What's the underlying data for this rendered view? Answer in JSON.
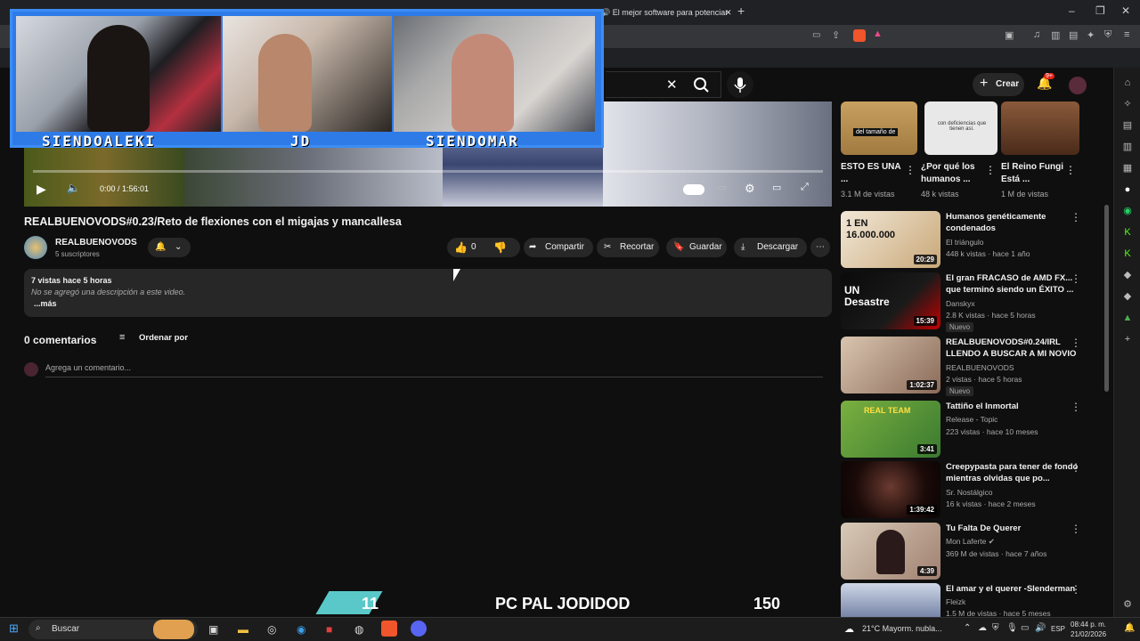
{
  "browser": {
    "tab_title": "El mejor software para potenciar",
    "new_tab": "+",
    "win_min": "–",
    "win_max": "❐",
    "win_close": "✕"
  },
  "overlay": {
    "cam_labels": [
      "SIENDOALEKI",
      "JD",
      "SIENDOMAR"
    ],
    "banner_left_number": "11",
    "banner_title": "PC PAL JODIDOD",
    "banner_right_number": "150"
  },
  "header": {
    "create_label": "Crear",
    "notif_count": "9+"
  },
  "player": {
    "time": "0:00 / 1:56:01"
  },
  "video": {
    "title": "REALBUENOVODS#0.23/Reto de flexiones con el migajas y mancallesa",
    "channel_name": "REALBUENOVODS",
    "subscribers": "5 suscriptores",
    "likes": "0",
    "share": "Compartir",
    "clip": "Recortar",
    "save": "Guardar",
    "download": "Descargar",
    "stats": "7 vistas  hace 5 horas",
    "description": "No se agregó una descripción a este video.",
    "more": "...más"
  },
  "comments": {
    "count_label": "0 comentarios",
    "sort_label": "Ordenar por",
    "placeholder": "Agrega un comentario..."
  },
  "shorts": [
    {
      "title": "ESTO ES UNA ...",
      "views": "3.1 M de vistas",
      "thumb_text": "del tamaño de"
    },
    {
      "title": "¿Por qué los humanos ...",
      "views": "48 k vistas",
      "thumb_text": "con deficiencias que tienen así."
    },
    {
      "title": "El Reino Fungi Está ...",
      "views": "1 M de vistas",
      "thumb_text": ""
    }
  ],
  "recommendations": [
    {
      "title": "Humanos genéticamente condenados",
      "channel": "El triángulo",
      "meta": "448 k vistas · hace 1 año",
      "duration": "20:29",
      "thumb_text": "1 EN 16.000.000",
      "badge": ""
    },
    {
      "title": "El gran FRACASO de AMD FX... que terminó siendo un ÉXITO ...",
      "channel": "Danskyx",
      "meta": "2.8 K vistas · hace 5 horas",
      "duration": "15:39",
      "thumb_text": "UN Desastre",
      "badge": "Nuevo"
    },
    {
      "title": "REALBUENOVODS#0.24/IRL LLENDO A BUSCAR A MI NOVIO",
      "channel": "REALBUENOVODS",
      "meta": "2 vistas · hace 5 horas",
      "duration": "1:02:37",
      "thumb_text": "",
      "badge": "Nuevo"
    },
    {
      "title": "Tattiño el Inmortal",
      "channel": "Release - Topic",
      "meta": "223 vistas · hace 10 meses",
      "duration": "3:41",
      "thumb_text": "REAL TEAM",
      "badge": ""
    },
    {
      "title": "Creepypasta para tener de fondo mientras olvidas que po...",
      "channel": "Sr. Nostálgico",
      "meta": "16 k vistas · hace 2 meses",
      "duration": "1:39:42",
      "thumb_text": "",
      "badge": ""
    },
    {
      "title": "Tu Falta De Querer",
      "channel": "Mon Laferte",
      "meta": "369 M de vistas · hace 7 años",
      "duration": "4:39",
      "thumb_text": "",
      "badge": ""
    },
    {
      "title": "El amar y el querer -Slenderman",
      "channel": "Fleizk",
      "meta": "1.5 M de vistas · hace 5 meses",
      "duration": "",
      "thumb_text": "",
      "badge": ""
    }
  ],
  "taskbar": {
    "search_label": "Buscar",
    "weather": "21°C  Mayorm. nubla...",
    "lang": "ESP",
    "time": "08:44 p. m.",
    "date": "21/02/2026"
  },
  "colors": {
    "accent_blue": "#3b8df5",
    "bg": "#0f0f0f",
    "notif_red": "#e62117"
  }
}
